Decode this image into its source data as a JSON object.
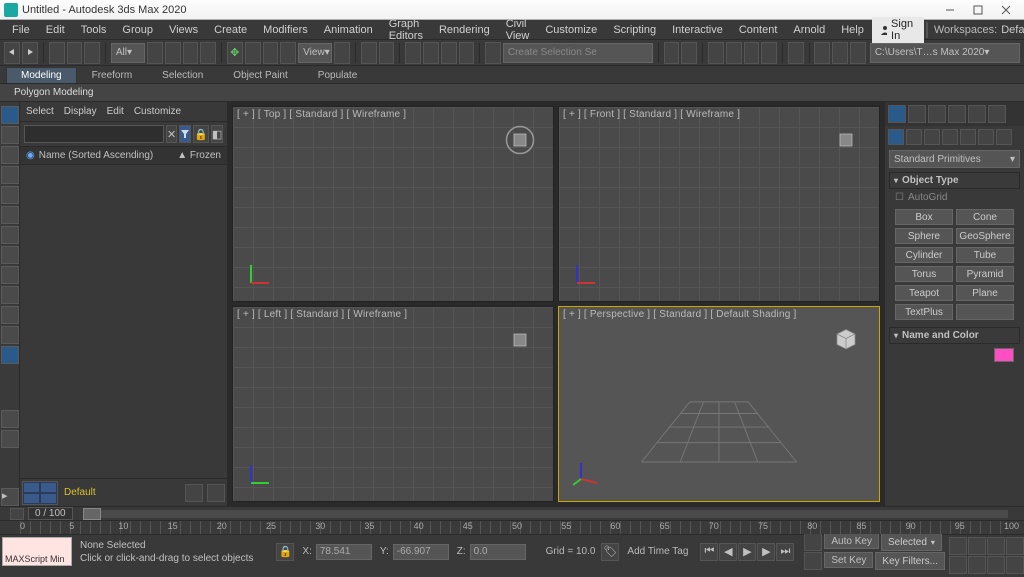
{
  "title": "Untitled - Autodesk 3ds Max 2020",
  "menus": [
    "File",
    "Edit",
    "Tools",
    "Group",
    "Views",
    "Create",
    "Modifiers",
    "Animation",
    "Graph Editors",
    "Rendering",
    "Civil View",
    "Customize",
    "Scripting",
    "Interactive",
    "Content",
    "Arnold",
    "Help"
  ],
  "sign_in": "Sign In",
  "workspaces_label": "Workspaces:",
  "workspaces_value": "Default",
  "toolbar": {
    "all": "All",
    "view": "View",
    "create_set": "Create Selection Se",
    "project_path": "C:\\Users\\T…s Max 2020"
  },
  "ribbon": {
    "tabs": [
      "Modeling",
      "Freeform",
      "Selection",
      "Object Paint",
      "Populate"
    ],
    "sub": "Polygon Modeling"
  },
  "scene_explorer": {
    "menus": [
      "Select",
      "Display",
      "Edit",
      "Customize"
    ],
    "name_col": "Name (Sorted Ascending)",
    "frozen_col": "▲ Frozen"
  },
  "viewports": {
    "top": "[ + ] [ Top ]  [ Standard ]  [ Wireframe ]",
    "front": "[ + ] [ Front ]  [ Standard ]  [ Wireframe ]",
    "left": "[ + ] [ Left ]  [ Standard ]  [ Wireframe ]",
    "persp": "[ + ] [ Perspective ]  [ Standard ]  [ Default Shading ]"
  },
  "cmd_panel": {
    "category": "Standard Primitives",
    "object_type": "Object Type",
    "autogrid": "AutoGrid",
    "prims": [
      "Box",
      "Cone",
      "Sphere",
      "GeoSphere",
      "Cylinder",
      "Tube",
      "Torus",
      "Pyramid",
      "Teapot",
      "Plane",
      "TextPlus",
      ""
    ],
    "name_color": "Name and Color"
  },
  "project_label": "Default",
  "frame_counter": "0 / 100",
  "ruler_ticks": [
    "0",
    "5",
    "10",
    "15",
    "20",
    "25",
    "30",
    "35",
    "40",
    "45",
    "50",
    "55",
    "60",
    "65",
    "70",
    "75",
    "80",
    "85",
    "90",
    "95",
    "100"
  ],
  "status": {
    "maxscript": "MAXScript Min",
    "selection": "None Selected",
    "prompt": "Click or click-and-drag to select objects",
    "x_label": "X:",
    "x_val": "78.541",
    "y_label": "Y:",
    "y_val": "-66.907",
    "z_label": "Z:",
    "z_val": "0.0",
    "grid": "Grid = 10.0",
    "add_time_tag": "Add Time Tag",
    "auto_key": "Auto Key",
    "selected": "Selected",
    "set_key": "Set Key",
    "key_filters": "Key Filters..."
  }
}
